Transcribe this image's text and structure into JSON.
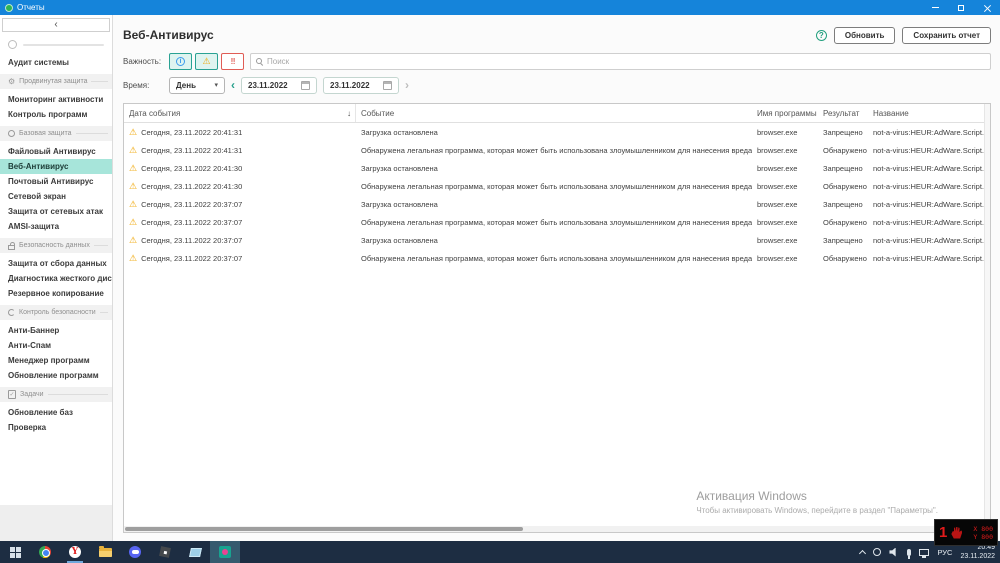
{
  "window": {
    "title": "Отчеты"
  },
  "sidebar": {
    "back_glyph": "‹",
    "entries": [
      {
        "kind": "item",
        "name": "audit-sistemy",
        "label": "Аудит системы"
      },
      {
        "kind": "section",
        "name": "prodvinutaya-zashchita",
        "icon": "gear-icon",
        "label": "Продвинутая защита"
      },
      {
        "kind": "item",
        "name": "monitoring-aktivnosti",
        "label": "Мониторинг активности"
      },
      {
        "kind": "item",
        "name": "kontrol-programm",
        "label": "Контроль программ"
      },
      {
        "kind": "section",
        "name": "bazovaya-zashchita",
        "icon": "circle-icon",
        "label": "Базовая защита"
      },
      {
        "kind": "item",
        "name": "faylovyy-antivirus",
        "label": "Файловый Антивирус"
      },
      {
        "kind": "item",
        "name": "veb-antivirus",
        "label": "Веб-Антивирус",
        "selected": true
      },
      {
        "kind": "item",
        "name": "pochtovyy-antivirus",
        "label": "Почтовый Антивирус"
      },
      {
        "kind": "item",
        "name": "setevoy-ekran",
        "label": "Сетевой экран"
      },
      {
        "kind": "item",
        "name": "zashchita-ot-setevykh-atak",
        "label": "Защита от сетевых атак"
      },
      {
        "kind": "item",
        "name": "amsi-zashchita",
        "label": "AMSI-защита"
      },
      {
        "kind": "section",
        "name": "bezopasnost-dannykh",
        "icon": "lock-icon",
        "label": "Безопасность данных"
      },
      {
        "kind": "item",
        "name": "zashchita-ot-sbora-dannykh",
        "label": "Защита от сбора данных"
      },
      {
        "kind": "item",
        "name": "diagnostika-zhestkogo-diska",
        "label": "Диагностика жесткого диска"
      },
      {
        "kind": "item",
        "name": "rezervnoe-kopirovanie",
        "label": "Резервное копирование"
      },
      {
        "kind": "section",
        "name": "kontrol-bezopasnosti",
        "icon": "sync-icon",
        "label": "Контроль безопасности"
      },
      {
        "kind": "item",
        "name": "anti-banner",
        "label": "Анти-Баннер"
      },
      {
        "kind": "item",
        "name": "anti-spam",
        "label": "Анти-Спам"
      },
      {
        "kind": "item",
        "name": "menedzher-programm",
        "label": "Менеджер программ"
      },
      {
        "kind": "item",
        "name": "obnovlenie-programm",
        "label": "Обновление программ"
      },
      {
        "kind": "section",
        "name": "zadachi",
        "icon": "tasks-icon",
        "label": "Задачи"
      },
      {
        "kind": "item",
        "name": "obnovlenie-baz",
        "label": "Обновление баз"
      },
      {
        "kind": "item",
        "name": "proverka",
        "label": "Проверка"
      }
    ]
  },
  "header": {
    "title": "Веб-Антивирус",
    "help_glyph": "?",
    "refresh_button": "Обновить",
    "save_button": "Сохранить отчет"
  },
  "filters": {
    "importance_label": "Важность:",
    "importance_buttons": [
      {
        "name": "info",
        "glyph": "i",
        "active": true
      },
      {
        "name": "warning",
        "glyph": "⚠",
        "active": true
      },
      {
        "name": "critical",
        "glyph": "‼",
        "active": false
      }
    ],
    "search_placeholder": "Поиск",
    "time_label": "Время:",
    "period_value": "День",
    "period_caret": "▾",
    "prev_arrow": "‹",
    "next_arrow": "›",
    "date_from": "23.11.2022",
    "date_to": "23.11.2022"
  },
  "table": {
    "columns": [
      "Дата события",
      "Событие",
      "Имя программы",
      "Результат",
      "Название"
    ],
    "sort_glyph": "↓",
    "warning_glyph": "⚠",
    "rows": [
      {
        "date": "Сегодня, 23.11.2022 20:41:31",
        "event": "Загрузка остановлена",
        "program": "browser.exe",
        "result": "Запрещено",
        "name": "not-a-virus:HEUR:AdWare.Script.Open"
      },
      {
        "date": "Сегодня, 23.11.2022 20:41:31",
        "event": "Обнаружена легальная программа, которая может быть использована злоумышленником для нанесения вреда компьютеру или данным пользователя",
        "program": "browser.exe",
        "result": "Обнаружено",
        "name": "not-a-virus:HEUR:AdWare.Script.Open"
      },
      {
        "date": "Сегодня, 23.11.2022 20:41:30",
        "event": "Загрузка остановлена",
        "program": "browser.exe",
        "result": "Запрещено",
        "name": "not-a-virus:HEUR:AdWare.Script.Open"
      },
      {
        "date": "Сегодня, 23.11.2022 20:41:30",
        "event": "Обнаружена легальная программа, которая может быть использована злоумышленником для нанесения вреда компьютеру или данным пользователя",
        "program": "browser.exe",
        "result": "Обнаружено",
        "name": "not-a-virus:HEUR:AdWare.Script.Open"
      },
      {
        "date": "Сегодня, 23.11.2022 20:37:07",
        "event": "Загрузка остановлена",
        "program": "browser.exe",
        "result": "Запрещено",
        "name": "not-a-virus:HEUR:AdWare.Script.Open"
      },
      {
        "date": "Сегодня, 23.11.2022 20:37:07",
        "event": "Обнаружена легальная программа, которая может быть использована злоумышленником для нанесения вреда компьютеру или данным пользователя",
        "program": "browser.exe",
        "result": "Обнаружено",
        "name": "not-a-virus:HEUR:AdWare.Script.Open"
      },
      {
        "date": "Сегодня, 23.11.2022 20:37:07",
        "event": "Загрузка остановлена",
        "program": "browser.exe",
        "result": "Запрещено",
        "name": "not-a-virus:HEUR:AdWare.Script.Open"
      },
      {
        "date": "Сегодня, 23.11.2022 20:37:07",
        "event": "Обнаружена легальная программа, которая может быть использована злоумышленником для нанесения вреда компьютеру или данным пользователя",
        "program": "browser.exe",
        "result": "Обнаружено",
        "name": "not-a-virus:HEUR:AdWare.Script.Open"
      }
    ]
  },
  "watermark": {
    "line1": "Активация Windows",
    "line2": "Чтобы активировать Windows, перейдите в раздел \"Параметры\"."
  },
  "overlay": {
    "counter": "1",
    "x_label": "X 800",
    "y_label": "Y 800"
  },
  "taskbar": {
    "icons": [
      "start",
      "chrome",
      "yandex",
      "explorer",
      "discord",
      "roblox",
      "notes",
      "kaspersky"
    ],
    "language": "РУС",
    "time": "20:49",
    "date": "23.11.2022"
  },
  "colors": {
    "titlebar": "#1584da",
    "accent_teal": "#27a08c",
    "selected_item_bg": "#a7e5da",
    "warning_orange": "#f0a500",
    "critical_red": "#e05c55",
    "info_blue": "#3d9bec",
    "taskbar_navy": "#1d2d42"
  }
}
